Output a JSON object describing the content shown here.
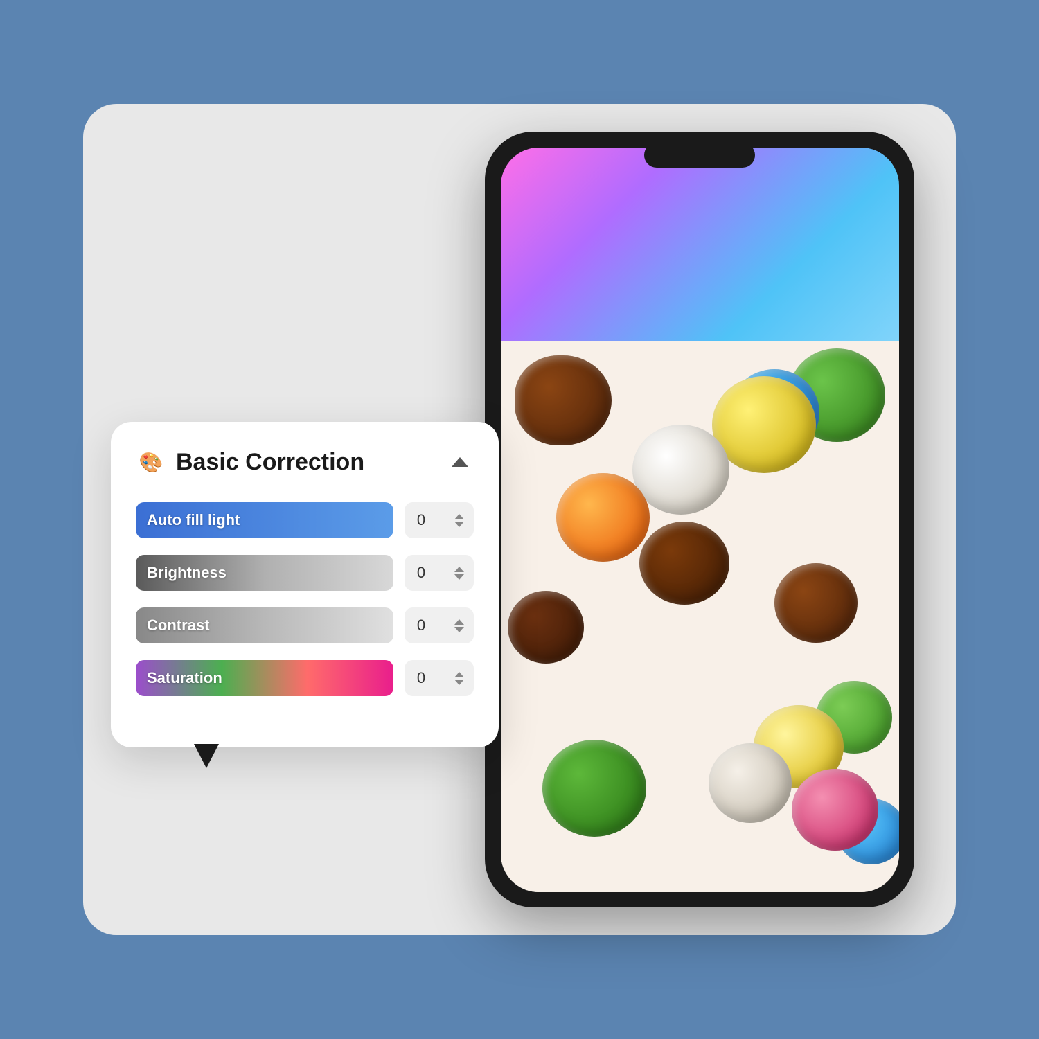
{
  "app": {
    "background_color": "#5b84b1"
  },
  "panel": {
    "title": "Basic Correction",
    "icon": "🎨",
    "controls": [
      {
        "id": "auto_fill_light",
        "label": "Auto fill light",
        "value": 0,
        "track_type": "autofill"
      },
      {
        "id": "brightness",
        "label": "Brightness",
        "value": 0,
        "track_type": "brightness"
      },
      {
        "id": "contrast",
        "label": "Contrast",
        "value": 0,
        "track_type": "contrast"
      },
      {
        "id": "saturation",
        "label": "Saturation",
        "value": 0,
        "track_type": "saturation"
      }
    ]
  },
  "phone": {
    "gradient_colors": [
      "#ff6ee8",
      "#b06cff",
      "#4fc3f7"
    ],
    "image_description": "colorful chocolate candy balls"
  }
}
